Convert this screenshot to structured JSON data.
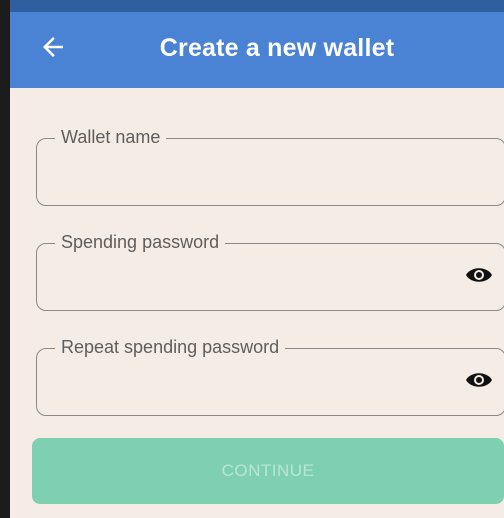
{
  "header": {
    "title": "Create a new wallet",
    "back_icon": "arrow-left-icon"
  },
  "form": {
    "wallet_name": {
      "label": "Wallet name",
      "value": ""
    },
    "spending_password": {
      "label": "Spending password",
      "value": "",
      "icon": "eye-icon"
    },
    "repeat_spending_password": {
      "label": "Repeat spending password",
      "value": "",
      "icon": "eye-icon"
    }
  },
  "continue_button": {
    "label": "CONTINUE",
    "enabled": false
  },
  "colors": {
    "app_bar": "#4a82d4",
    "background": "#f6ece6",
    "button": "#7fcfb3",
    "button_text": "#b6e6d4"
  }
}
